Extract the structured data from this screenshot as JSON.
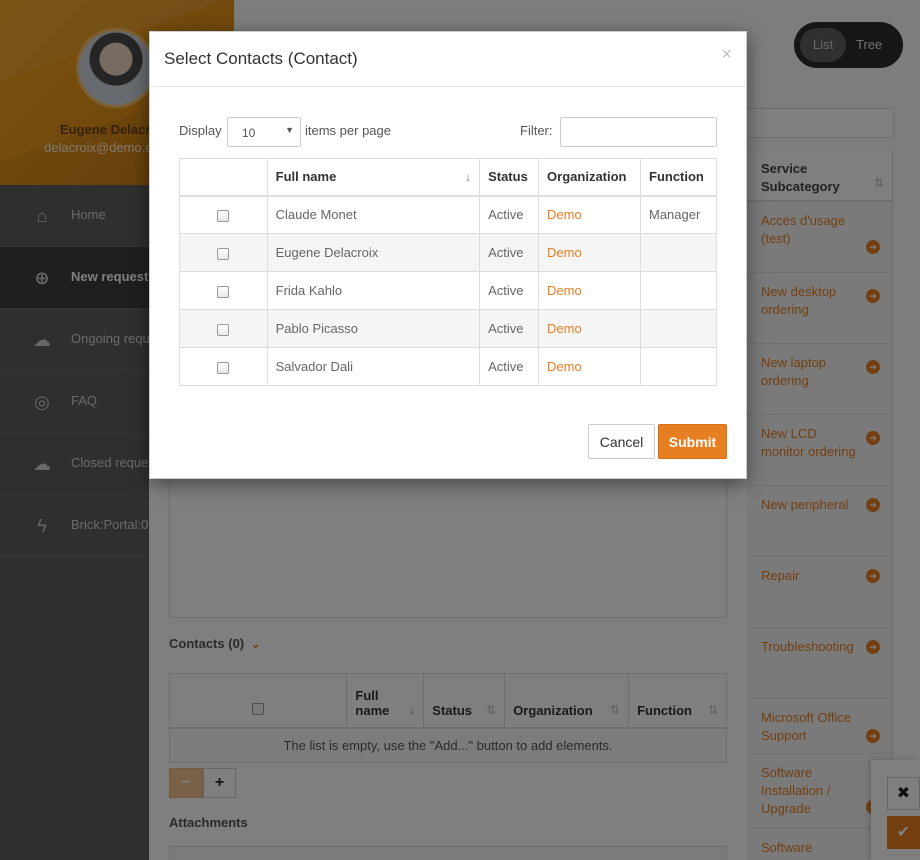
{
  "profile": {
    "name": "Eugene Delacroix",
    "email": "delacroix@demo.com"
  },
  "nav": [
    {
      "icon": "home-icon",
      "glyph": "⌂",
      "label": "Home",
      "active": false
    },
    {
      "icon": "plus-circle-icon",
      "glyph": "⊕",
      "label": "New request",
      "active": true
    },
    {
      "icon": "chat-icon",
      "glyph": "☁",
      "label": "Ongoing requests",
      "active": false
    },
    {
      "icon": "lifebuoy-icon",
      "glyph": "◎",
      "label": "FAQ",
      "active": false
    },
    {
      "icon": "chat-closed-icon",
      "glyph": "☁",
      "label": "Closed requests",
      "active": false
    },
    {
      "icon": "bolt-icon",
      "glyph": "ϟ",
      "label": "Brick:Portal:0",
      "active": false
    }
  ],
  "view_toggle": {
    "list": "List",
    "tree": "Tree"
  },
  "subcategory": {
    "header": "Service Subcategory",
    "rows": [
      "Accès d'usage (test)",
      "New desktop ordering",
      "New laptop ordering",
      "New LCD monitor ordering",
      "New peripheral",
      "Repair",
      "Troubleshooting",
      "Microsoft Office Support",
      "Software Installation / Upgrade",
      "Software removal"
    ]
  },
  "form": {
    "contacts_title": "Contacts",
    "contacts_count": "(0)",
    "columns": [
      "Full name",
      "Status",
      "Organization",
      "Function"
    ],
    "empty_message": "The list is empty, use the \"Add...\" button to add elements.",
    "remove_label": "−",
    "add_label": "+",
    "attachments_title": "Attachments"
  },
  "modal": {
    "title": "Select Contacts (Contact)",
    "close": "×",
    "display_label": "Display",
    "per_page_value": "10",
    "items_per_page_label": "items per page",
    "filter_label": "Filter:",
    "filter_value": "",
    "columns": [
      "Full name",
      "Status",
      "Organization",
      "Function"
    ],
    "rows": [
      {
        "name": "Claude Monet",
        "status": "Active",
        "org": "Demo",
        "function": "Manager"
      },
      {
        "name": "Eugene Delacroix",
        "status": "Active",
        "org": "Demo",
        "function": ""
      },
      {
        "name": "Frida Kahlo",
        "status": "Active",
        "org": "Demo",
        "function": ""
      },
      {
        "name": "Pablo Picasso",
        "status": "Active",
        "org": "Demo",
        "function": ""
      },
      {
        "name": "Salvador Dali",
        "status": "Active",
        "org": "Demo",
        "function": ""
      }
    ],
    "cancel_label": "Cancel",
    "submit_label": "Submit"
  },
  "float_actions": {
    "cancel_glyph": "✖",
    "ok_glyph": "✔"
  },
  "colors": {
    "accent": "#e67e22",
    "sidebar": "#5e5e5e"
  }
}
